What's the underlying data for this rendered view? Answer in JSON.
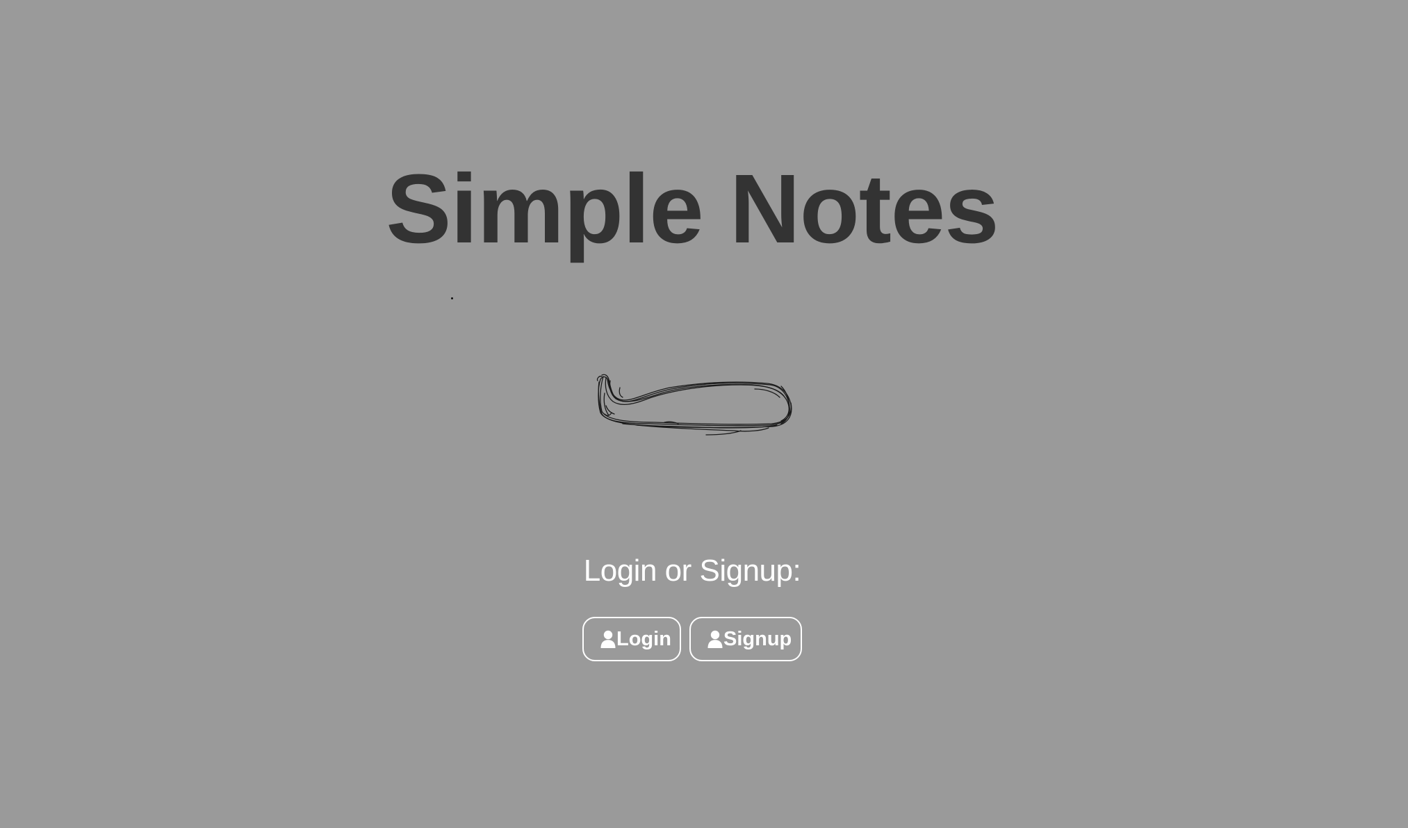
{
  "header": {
    "title": "Simple Notes"
  },
  "auth": {
    "prompt": "Login or Signup:",
    "login_label": "Login",
    "signup_label": "Signup",
    "icon": "user-icon"
  },
  "colors": {
    "background": "#9a9a9a",
    "title": "#333333",
    "text_light": "#ffffff"
  }
}
